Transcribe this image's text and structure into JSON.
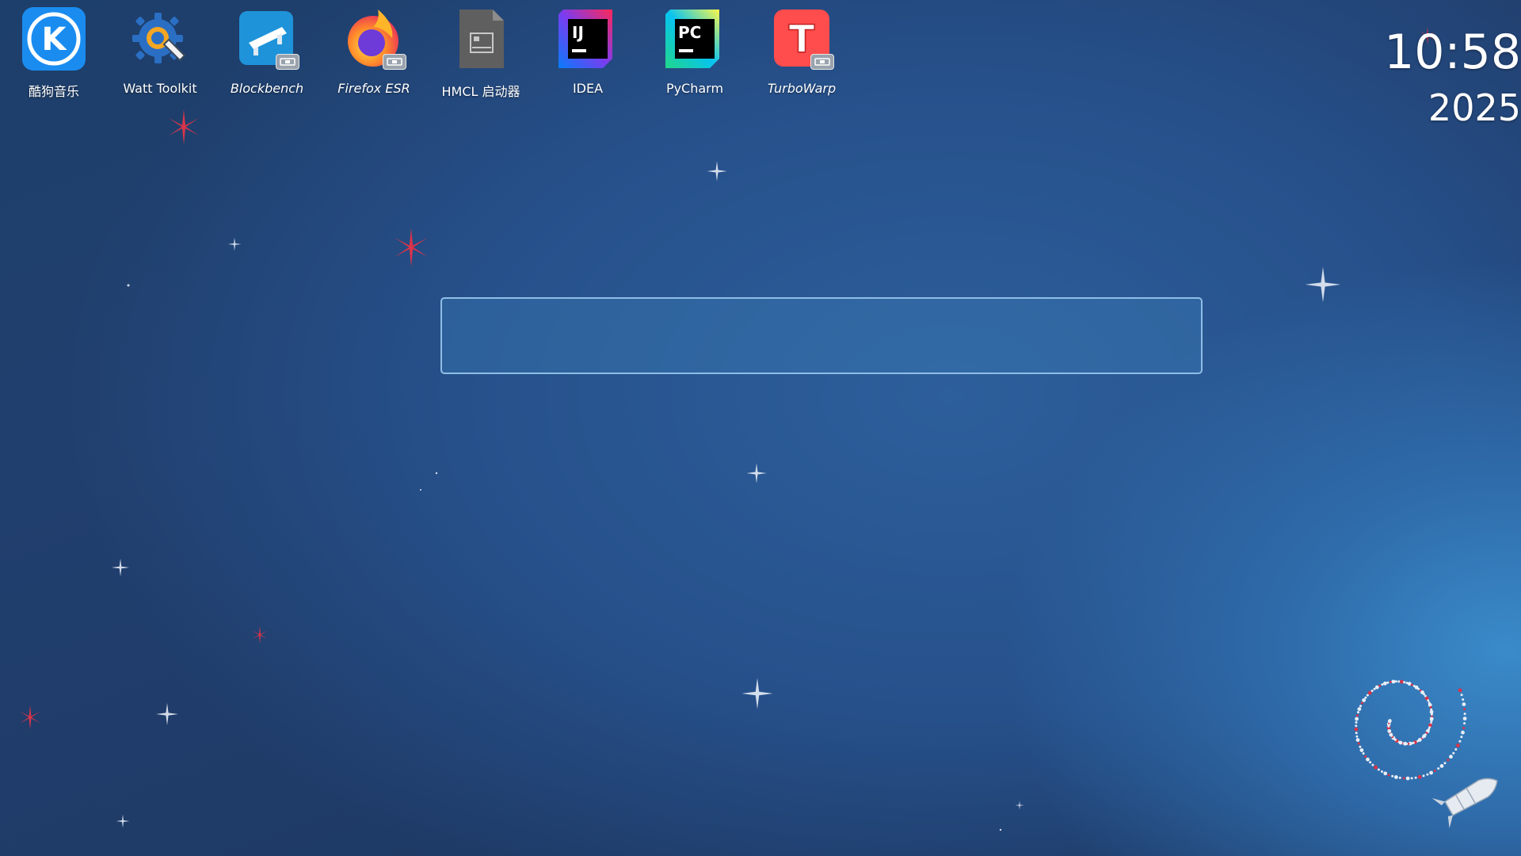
{
  "desktop": {
    "icons": [
      {
        "label": "酷狗音乐",
        "icon": "kugou-music-icon"
      },
      {
        "label": "Watt Toolkit",
        "icon": "watt-toolkit-icon"
      },
      {
        "label": "Blockbench",
        "icon": "blockbench-icon"
      },
      {
        "label": "Firefox ESR",
        "icon": "firefox-icon"
      },
      {
        "label": "HMCL 启动器",
        "icon": "hmcl-launcher-icon"
      },
      {
        "label": "IDEA",
        "icon": "intellij-idea-icon"
      },
      {
        "label": "PyCharm",
        "icon": "pycharm-icon"
      },
      {
        "label": "TurboWarp",
        "icon": "turbowarp-icon"
      }
    ],
    "idea_logo_text": "IJ",
    "pycharm_logo_text": "PC",
    "kugou_logo_text": "K",
    "turbowarp_logo_text": "T"
  },
  "clock": {
    "time": "10:58",
    "date": "2025"
  },
  "search": {
    "value": "",
    "placeholder": ""
  },
  "colors": {
    "accent": "#8fbde6",
    "star_red": "#d9344a",
    "star_white": "#e8eef7"
  }
}
